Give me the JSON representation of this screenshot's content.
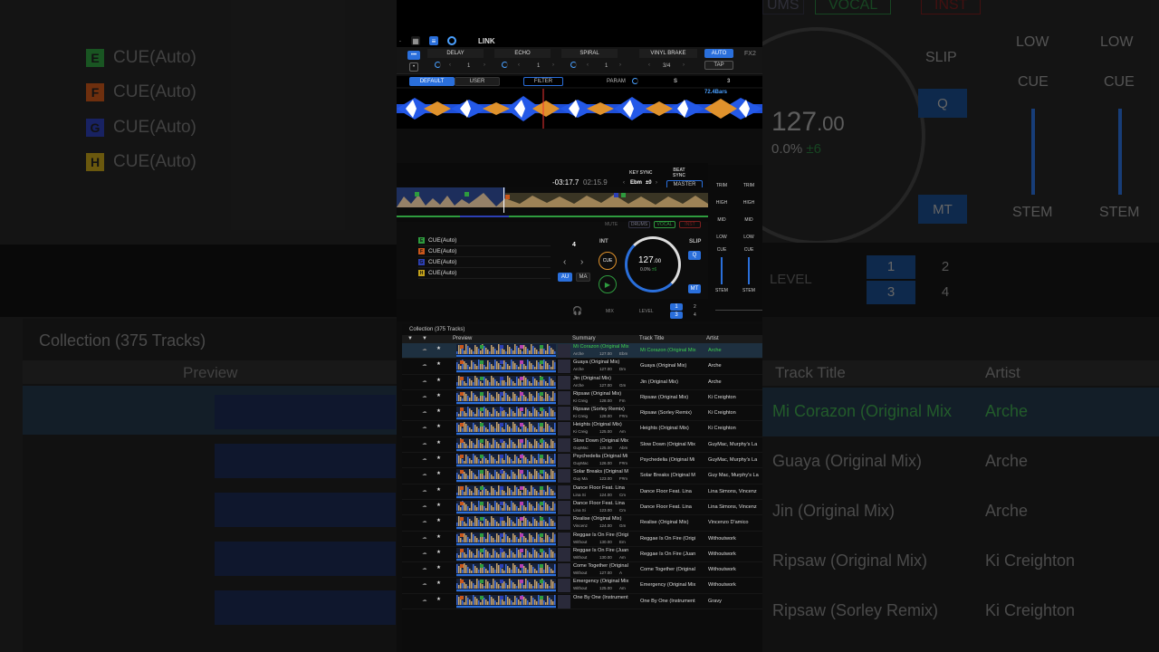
{
  "background": {
    "cues": [
      {
        "letter": "E",
        "label": "CUE(Auto)",
        "color": "#2e9b3e"
      },
      {
        "letter": "F",
        "label": "CUE(Auto)",
        "color": "#c9561b"
      },
      {
        "letter": "G",
        "label": "CUE(Auto)",
        "color": "#2c3fb3"
      },
      {
        "letter": "H",
        "label": "CUE(Auto)",
        "color": "#c2a11b"
      }
    ],
    "collection_title": "Collection (375 Tracks)",
    "preview_header": "Preview",
    "track_title_header": "Track Title",
    "artist_header": "Artist",
    "tracks": [
      {
        "title": "Mi Corazon (Original Mix",
        "artist": "Arche"
      },
      {
        "title": "Guaya (Original Mix)",
        "artist": "Arche"
      },
      {
        "title": "Jin (Original Mix)",
        "artist": "Arche"
      },
      {
        "title": "Ripsaw (Original Mix)",
        "artist": "Ki Creighton"
      },
      {
        "title": "Ripsaw (Sorley Remix)",
        "artist": "Ki Creighton"
      }
    ],
    "right_labels": {
      "low": "LOW",
      "low2": "LOW",
      "slip": "SLIP",
      "cue": "CUE",
      "cue2": "CUE",
      "q": "Q",
      "mt": "MT",
      "stem": "STEM",
      "stem2": "STEM",
      "level": "LEVEL",
      "n1": "1",
      "n2": "2",
      "n3": "3",
      "n4": "4",
      "bpm": "127",
      "bpm_dec": ".00",
      "pitch": "0.0%",
      "pitch_range": "±6",
      "ums": "UMS",
      "vocal": "VOCAL",
      "inst": "INST"
    }
  },
  "toolbar": {
    "link": "LINK"
  },
  "fx": {
    "delay": "DELAY",
    "echo": "ECHO",
    "spiral": "SPIRAL",
    "vinyl_brake": "VINYL BRAKE",
    "auto": "AUTO",
    "tap": "TAP",
    "fx2": "FX2",
    "beat": "1",
    "beat2": "1",
    "beat3": "1",
    "beat4": "3/4"
  },
  "tabs": {
    "default": "DEFAULT",
    "user": "USER",
    "filter": "FILTER",
    "param": "PARAM",
    "s": "S",
    "three": "3"
  },
  "wave": {
    "bars": "72.4Bars"
  },
  "deck": {
    "remain": "-03:17.7",
    "elapsed": "02:15.9",
    "key_sync": "KEY SYNC",
    "beat_sync": "BEAT SYNC",
    "key": "Ebm",
    "key_offset": "±0",
    "master": "MASTER",
    "mute": "MUTE",
    "drums": "DRUMS",
    "vocal": "VOCAL",
    "inst": "INST",
    "beat_jump": "4",
    "int": "INT",
    "cue_btn": "CUE",
    "au": "AU",
    "ma": "MA",
    "bpm": "127",
    "bpm_dec": ".00",
    "pitch": "0.0%",
    "pitch_range": "±6",
    "slip": "SLIP",
    "q": "Q",
    "mt": "MT"
  },
  "cues": [
    {
      "letter": "E",
      "label": "CUE(Auto)",
      "color": "#2e9b3e"
    },
    {
      "letter": "F",
      "label": "CUE(Auto)",
      "color": "#c9561b"
    },
    {
      "letter": "G",
      "label": "CUE(Auto)",
      "color": "#2c3fb3"
    },
    {
      "letter": "H",
      "label": "CUE(Auto)",
      "color": "#c2a11b"
    }
  ],
  "mixer": {
    "trim": "TRIM",
    "high": "HIGH",
    "mid": "MID",
    "low": "LOW",
    "cue": "CUE",
    "stem": "STEM"
  },
  "bottom_mixer": {
    "mix": "MIX",
    "level": "LEVEL",
    "n1": "1",
    "n2": "2",
    "n3": "3",
    "n4": "4"
  },
  "collection": {
    "title": "Collection (375 Tracks)",
    "headers": {
      "preview": "Preview",
      "summary": "Summary",
      "title": "Track Title",
      "artist": "Artist"
    },
    "rows": [
      {
        "sum1": "Mi Corazon (Original Mix",
        "sum2": "Arche",
        "bpm": "127.00",
        "key": "Ebm",
        "title": "Mi Corazon (Original Mix",
        "artist": "Arche"
      },
      {
        "sum1": "Guaya (Original Mix)",
        "sum2": "Arche",
        "bpm": "127.00",
        "key": "Dm",
        "title": "Guaya (Original Mix)",
        "artist": "Arche"
      },
      {
        "sum1": "Jin (Original Mix)",
        "sum2": "Arche",
        "bpm": "127.00",
        "key": "Gm",
        "title": "Jin (Original Mix)",
        "artist": "Arche"
      },
      {
        "sum1": "Ripsaw (Original Mix)",
        "sum2": "Ki Creig",
        "bpm": "128.00",
        "key": "Fm",
        "title": "Ripsaw (Original Mix)",
        "artist": "Ki Creighton"
      },
      {
        "sum1": "Ripsaw (Sorley Remix)",
        "sum2": "Ki Creig",
        "bpm": "128.00",
        "key": "F#m",
        "title": "Ripsaw (Sorley Remix)",
        "artist": "Ki Creighton"
      },
      {
        "sum1": "Heights (Original Mix)",
        "sum2": "Ki Creig",
        "bpm": "125.00",
        "key": "Am",
        "title": "Heights (Original Mix)",
        "artist": "Ki Creighton"
      },
      {
        "sum1": "Slow Down (Original Mix",
        "sum2": "GuyMac",
        "bpm": "125.00",
        "key": "Abm",
        "title": "Slow Down (Original Mix",
        "artist": "GuyMac, Murphy's La"
      },
      {
        "sum1": "Psychedelia (Original Mi",
        "sum2": "GuyMac",
        "bpm": "126.00",
        "key": "F#m",
        "title": "Psychedelia (Original Mi",
        "artist": "GuyMac, Murphy's La"
      },
      {
        "sum1": "Solar Breaks (Original M",
        "sum2": "Guy Ma",
        "bpm": "123.00",
        "key": "F#m",
        "title": "Solar Breaks (Original M",
        "artist": "Guy Mac, Murphy's La"
      },
      {
        "sum1": "Dance Floor Feat. Lina",
        "sum2": "Lina Si",
        "bpm": "124.00",
        "key": "Cm",
        "title": "Dance Floor Feat. Lina",
        "artist": "Lina Simons, Vincenz"
      },
      {
        "sum1": "Dance Floor Feat. Lina",
        "sum2": "Lina Si",
        "bpm": "123.00",
        "key": "Cm",
        "title": "Dance Floor Feat. Lina",
        "artist": "Lina Simons, Vincenz"
      },
      {
        "sum1": "Realise (Original Mix)",
        "sum2": "Vincenz",
        "bpm": "124.00",
        "key": "Gm",
        "title": "Realise (Original Mix)",
        "artist": "Vincenzo D'amico"
      },
      {
        "sum1": "Reggae Is On Fire (Origi",
        "sum2": "Without",
        "bpm": "130.00",
        "key": "Em",
        "title": "Reggae Is On Fire (Origi",
        "artist": "Withoutwork"
      },
      {
        "sum1": "Reggae Is On Fire (Juan",
        "sum2": "Without",
        "bpm": "130.00",
        "key": "Am",
        "title": "Reggae Is On Fire (Juan",
        "artist": "Withoutwork"
      },
      {
        "sum1": "Come Together (Original",
        "sum2": "Without",
        "bpm": "127.00",
        "key": "A",
        "title": "Come Together (Original",
        "artist": "Withoutwork"
      },
      {
        "sum1": "Emergency (Original Mix",
        "sum2": "Without",
        "bpm": "125.00",
        "key": "Am",
        "title": "Emergency (Original Mix",
        "artist": "Withoutwork"
      },
      {
        "sum1": "One By One (Instrument",
        "sum2": "",
        "bpm": "",
        "key": "",
        "title": "One By One (Instrument",
        "artist": "Gravy"
      }
    ]
  }
}
